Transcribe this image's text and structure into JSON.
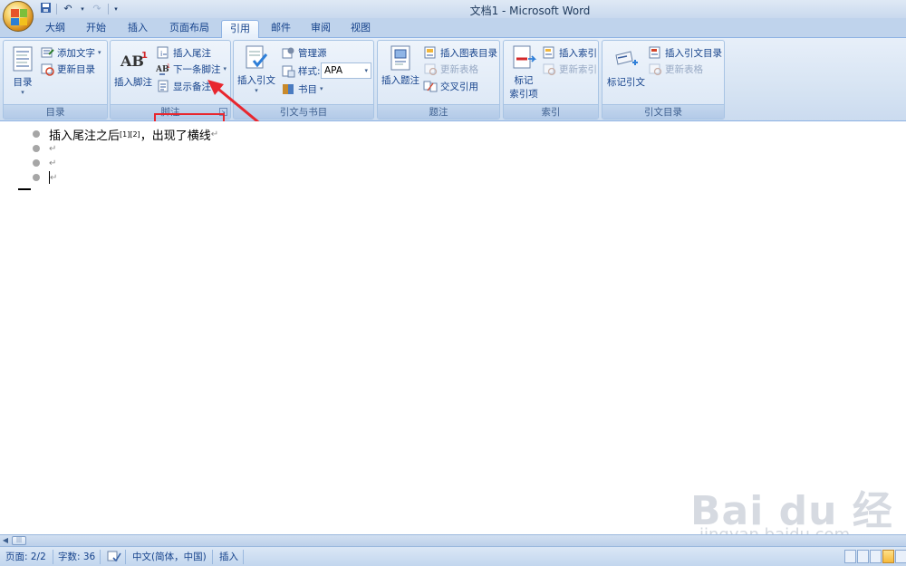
{
  "window": {
    "title": "文档1 - Microsoft Word"
  },
  "tabs": [
    "大纲",
    "开始",
    "插入",
    "页面布局",
    "引用",
    "邮件",
    "审阅",
    "视图"
  ],
  "active_tab": "引用",
  "ribbon": {
    "toc": {
      "group_label": "目录",
      "toc_button": "目录",
      "add_text": "添加文字",
      "update_toc": "更新目录"
    },
    "footnotes": {
      "group_label": "脚注",
      "insert_footnote": "插入脚注",
      "insert_endnote": "插入尾注",
      "next_footnote": "下一条脚注",
      "show_notes": "显示备注"
    },
    "citations": {
      "group_label": "引文与书目",
      "insert_citation": "插入引文",
      "manage_sources": "管理源",
      "style_label": "样式:",
      "style_value": "APA",
      "bibliography": "书目"
    },
    "captions": {
      "group_label": "题注",
      "insert_caption": "插入题注",
      "insert_table_of_figures": "插入图表目录",
      "update_table": "更新表格",
      "cross_reference": "交叉引用"
    },
    "index": {
      "group_label": "索引",
      "mark_entry_line1": "标记",
      "mark_entry_line2": "索引项",
      "insert_index": "插入索引",
      "update_index": "更新索引"
    },
    "toa": {
      "group_label": "引文目录",
      "mark_citation": "标记引文",
      "insert_toa": "插入引文目录",
      "update_table": "更新表格"
    }
  },
  "document": {
    "line1_text": "插入尾注之后",
    "line1_sup": "[1][2]",
    "line1_rest": "，出现了横线",
    "pilcrow": "↵"
  },
  "status": {
    "page": "页面: 2/2",
    "words": "字数: 36",
    "language": "中文(简体，中国)",
    "mode": "插入"
  },
  "watermark": {
    "main": "Bai du 经验",
    "sub": "jingyan.baidu.com"
  },
  "colors": {
    "ribbon_text": "#15428b",
    "annotation_red": "#e8262e"
  }
}
